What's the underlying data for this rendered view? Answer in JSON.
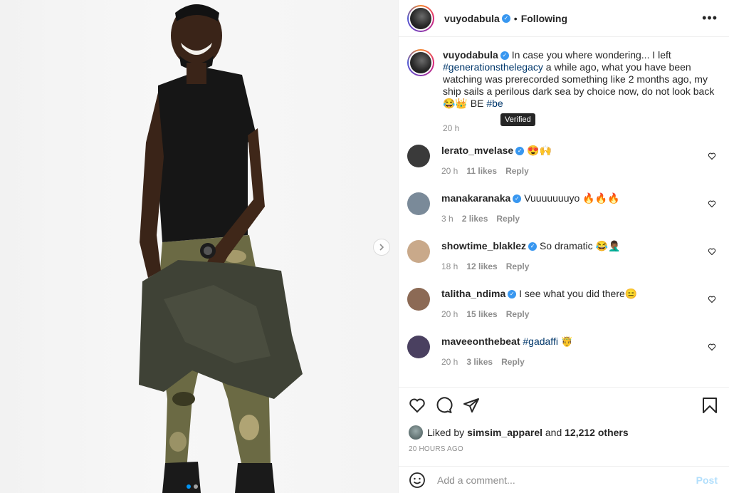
{
  "post": {
    "author": "vuyodabula",
    "follow_separator": "•",
    "follow_status": "Following",
    "more_icon": "more-horizontal-icon",
    "photo_alt_icon": "chevron-right-icon"
  },
  "caption": {
    "username": "vuyodabula",
    "text_before": "In case you where wondering... I left ",
    "hashtag1": "#generationsthelegacy",
    "text_middle": " a while ago, what you have been watching was prerecorded something like 2 months ago, my ship sails a perilous dark sea by choice now, do not look back 😂👑 BE ",
    "hashtag2": "#be",
    "time": "20 h",
    "tooltip": "Verified"
  },
  "comments": [
    {
      "username": "lerato_mvelase",
      "text": "😍🙌",
      "time": "20 h",
      "likes": "11 likes",
      "reply": "Reply",
      "avatar_color": "#3a3a3a"
    },
    {
      "username": "manakaranaka",
      "text": "Vuuuuuuuyo 🔥🔥🔥",
      "time": "3 h",
      "likes": "2 likes",
      "reply": "Reply",
      "avatar_color": "#7a8a99"
    },
    {
      "username": "showtime_blaklez",
      "text": "So dramatic 😂🤦🏾‍♂️",
      "time": "18 h",
      "likes": "12 likes",
      "reply": "Reply",
      "avatar_color": "#c9a98a"
    },
    {
      "username": "talitha_ndima",
      "text": "I see what you did there😑",
      "time": "20 h",
      "likes": "15 likes",
      "reply": "Reply",
      "avatar_color": "#8c6a55"
    },
    {
      "username": "maveeonthebeat",
      "hashtag": "#gadaffi",
      "text": " 🤴",
      "time": "20 h",
      "likes": "3 likes",
      "reply": "Reply",
      "avatar_color": "#4a4060"
    }
  ],
  "likes": {
    "prefix": "Liked by ",
    "user": "simsim_apparel",
    "suffix": " and ",
    "count": "12,212 others"
  },
  "posted_ago": "20 HOURS AGO",
  "add_comment": {
    "placeholder": "Add a comment...",
    "post_label": "Post"
  },
  "colors": {
    "verified": "#3897f0",
    "hashtag": "#00376b",
    "muted": "#8e8e8e",
    "post_disabled": "#b2dffc"
  }
}
